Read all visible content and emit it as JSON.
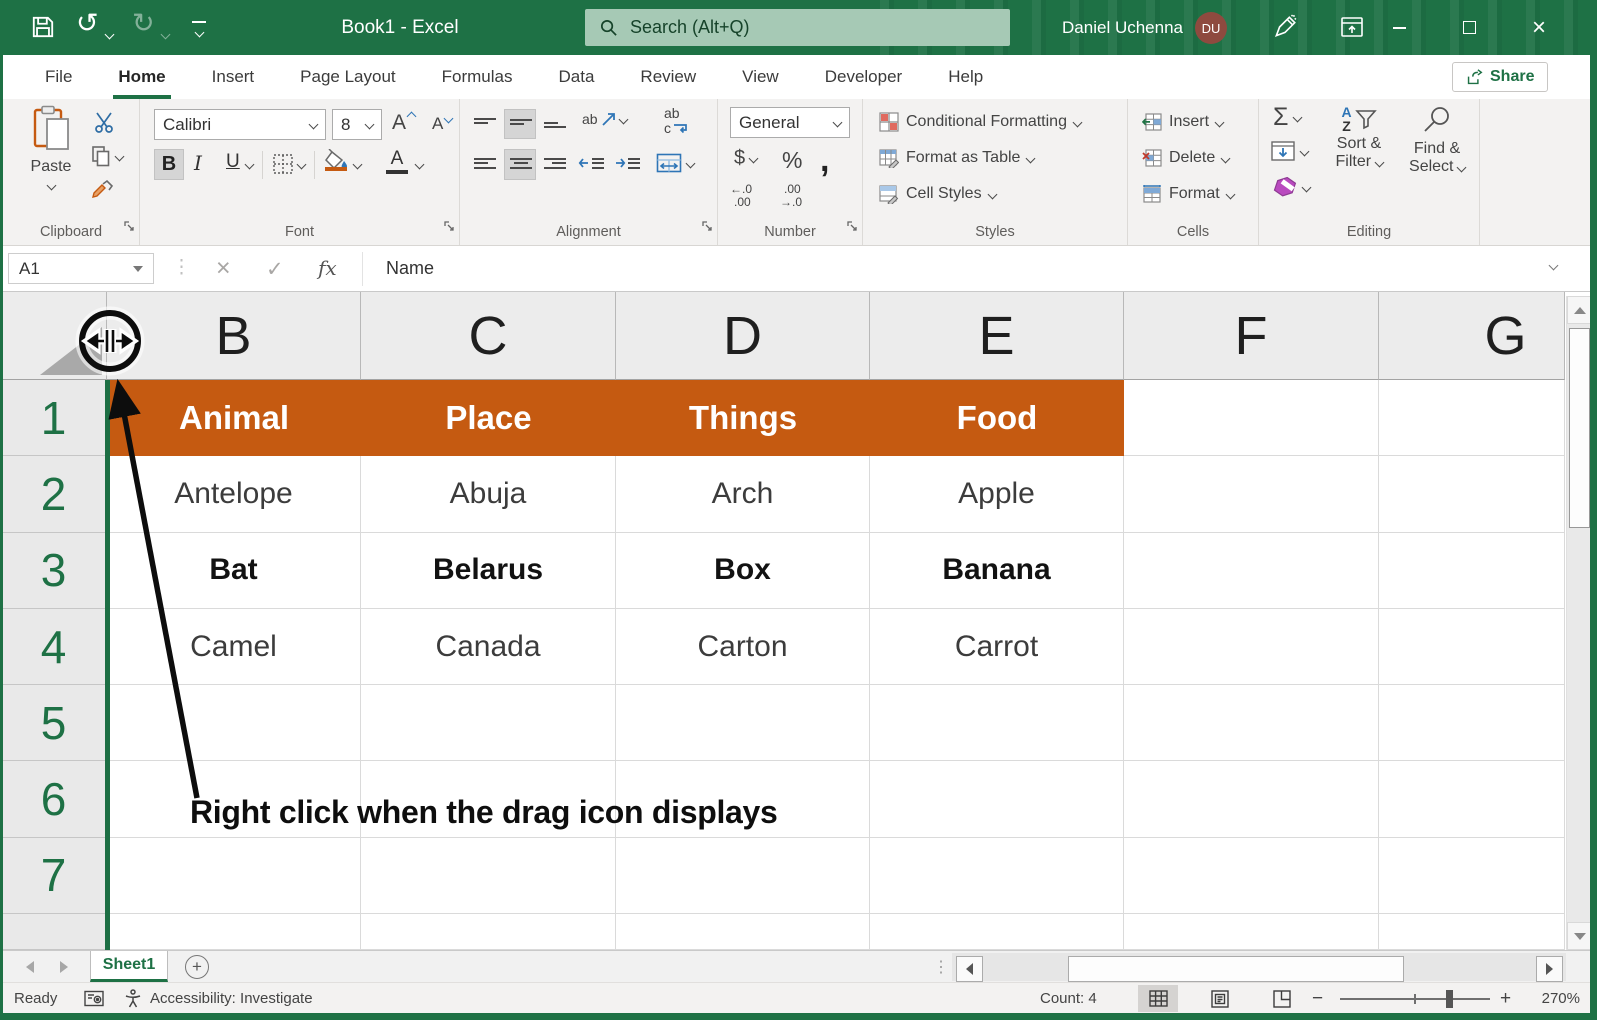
{
  "titlebar": {
    "title": "Book1 - Excel",
    "search": "Search (Alt+Q)",
    "user_name": "Daniel Uchenna",
    "user_initials": "DU"
  },
  "menubar": {
    "tabs": [
      "File",
      "Home",
      "Insert",
      "Page Layout",
      "Formulas",
      "Data",
      "Review",
      "View",
      "Developer",
      "Help"
    ],
    "active_tab": "Home",
    "share": "Share"
  },
  "ribbon": {
    "clipboard": {
      "group": "Clipboard",
      "paste": "Paste"
    },
    "font": {
      "group": "Font",
      "family": "Calibri",
      "size": "8",
      "bold": "B",
      "italic": "I",
      "underline": "U",
      "grow": "A",
      "shrink": "A",
      "color_a": "A"
    },
    "alignment": {
      "group": "Alignment",
      "ab": "ab",
      "wrap_ab": "ab",
      "wrap_c": "c"
    },
    "number": {
      "group": "Number",
      "format": "General",
      "currency": "$",
      "percent": "%",
      "comma": ",",
      "inc_top": "←.0",
      "inc_bot": ".00",
      "dec_top": ".00",
      "dec_bot": "→.0"
    },
    "styles": {
      "group": "Styles",
      "conditional_formatting": "Conditional Formatting",
      "format_as_table": "Format as Table",
      "cell_styles": "Cell Styles"
    },
    "cells": {
      "group": "Cells",
      "insert": "Insert",
      "delete": "Delete",
      "format": "Format"
    },
    "editing": {
      "group": "Editing",
      "autosum": "Σ",
      "a": "A",
      "z": "Z",
      "sort_line1": "Sort &",
      "sort_line2": "Filter",
      "find_line1": "Find &",
      "find_line2": "Select"
    }
  },
  "formula_bar": {
    "name_box": "A1",
    "cancel": "×",
    "enter": "✓",
    "fx": "fx",
    "content": "Name"
  },
  "sheet": {
    "columns": [
      "B",
      "C",
      "D",
      "E",
      "F",
      "G"
    ],
    "row_numbers": [
      "1",
      "2",
      "3",
      "4",
      "5",
      "6",
      "7"
    ],
    "header_row": [
      "Animal",
      "Place",
      "Things",
      "Food"
    ],
    "data_rows": [
      [
        "Antelope",
        "Abuja",
        "Arch",
        "Apple"
      ],
      [
        "Bat",
        "Belarus",
        "Box",
        "Banana"
      ],
      [
        "Camel",
        "Canada",
        "Carton",
        "Carrot"
      ]
    ],
    "annotation": "Right click when the drag icon displays"
  },
  "sheet_tabs": {
    "active": "Sheet1",
    "add": "+"
  },
  "status_bar": {
    "mode": "Ready",
    "accessibility": "Accessibility: Investigate",
    "count": "Count: 4",
    "zoom_out": "−",
    "zoom_in": "+",
    "zoom_level": "270%"
  },
  "colors": {
    "excel_green": "#1E7145",
    "header_fill": "#C55A11"
  }
}
